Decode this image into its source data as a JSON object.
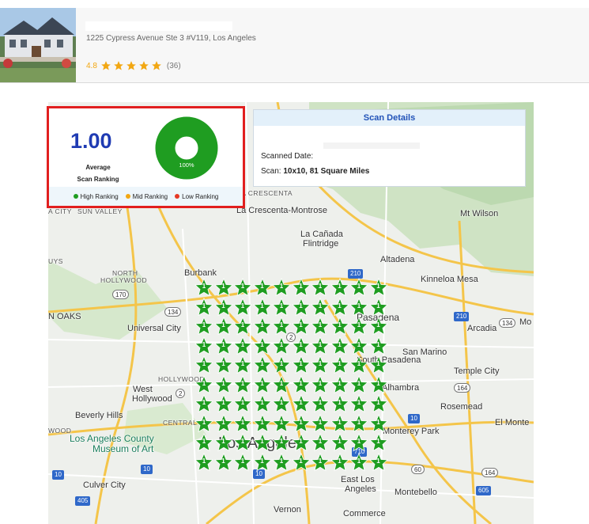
{
  "business": {
    "address": "1225 Cypress Avenue Ste 3 #V119, Los Angeles",
    "rating": "4.8",
    "review_count": "(36)",
    "stars": 5
  },
  "score_card": {
    "average_value": "1.00",
    "average_label_line1": "Average",
    "average_label_line2": "Scan Ranking",
    "donut_percent": "100%",
    "donut_fraction": 1.0,
    "legend": [
      {
        "label": "High Ranking",
        "color": "#1f9d21"
      },
      {
        "label": "Mid Ranking",
        "color": "#f2a712"
      },
      {
        "label": "Low Ranking",
        "color": "#e53925"
      }
    ]
  },
  "scan_details": {
    "title": "Scan Details",
    "scanned_date_label": "Scanned Date:",
    "scan_label": "Scan:",
    "scan_value": "10x10, 81 Square Miles"
  },
  "grid": {
    "rows": 10,
    "cols": 10,
    "rank_value": "1",
    "pin_color": "#1f9d21"
  },
  "map_labels": {
    "la_crescenta": "LA CRESCENTA",
    "la_crescenta_montrose": "La Crescenta-Montrose",
    "mt_wilson": "Mt Wilson",
    "la_canada": "La Cañada",
    "flintridge": "Flintridge",
    "altadena": "Altadena",
    "burbank": "Burbank",
    "kinneloa_mesa": "Kinneloa Mesa",
    "north_hollywood_1": "NORTH",
    "north_hollywood_2": "HOLLYWOOD",
    "pasadena": "Pasadena",
    "arcadia": "Arcadia",
    "universal_city": "Universal City",
    "san_marino": "San Marino",
    "temple_city": "Temple City",
    "south_pasadena": "South Pasadena",
    "alhambra": "Alhambra",
    "west_hollywood_1": "West",
    "west_hollywood_2": "Hollywood",
    "hollywood": "HOLLYWOOD",
    "rosemead": "Rosemead",
    "beverly_hills": "Beverly Hills",
    "central": "CENTRAL",
    "el_monte": "El Monte",
    "monterey_park": "Monterey Park",
    "lacma_1": "Los Angeles County",
    "lacma_2": "Museum of Art",
    "los_angeles": "Los Angeles",
    "culver_city": "Culver City",
    "east_los_angeles_1": "East Los",
    "east_los_angeles_2": "Angeles",
    "montebello": "Montebello",
    "commerce": "Commerce",
    "vernon": "Vernon",
    "sun_valley": "SUN VALLEY",
    "oaks": "N OAKS",
    "uys": "UYS",
    "wood": "WOOD",
    "city_edge": "A CITY",
    "mo": "Mo"
  },
  "shields": {
    "s170": "170",
    "s134": "134",
    "s210a": "210",
    "s210b": "210",
    "s134b": "134",
    "s2a": "2",
    "s2b": "2",
    "s164a": "164",
    "s10a": "10",
    "s10b": "10",
    "s10c": "10",
    "s710": "710",
    "s60": "60",
    "s164b": "164",
    "s605": "605",
    "s405": "405",
    "s10d": "10"
  },
  "colors": {
    "accent_blue": "#1f3bb3",
    "highlight_border": "#e11f1f",
    "rating_star": "#f2a712"
  }
}
